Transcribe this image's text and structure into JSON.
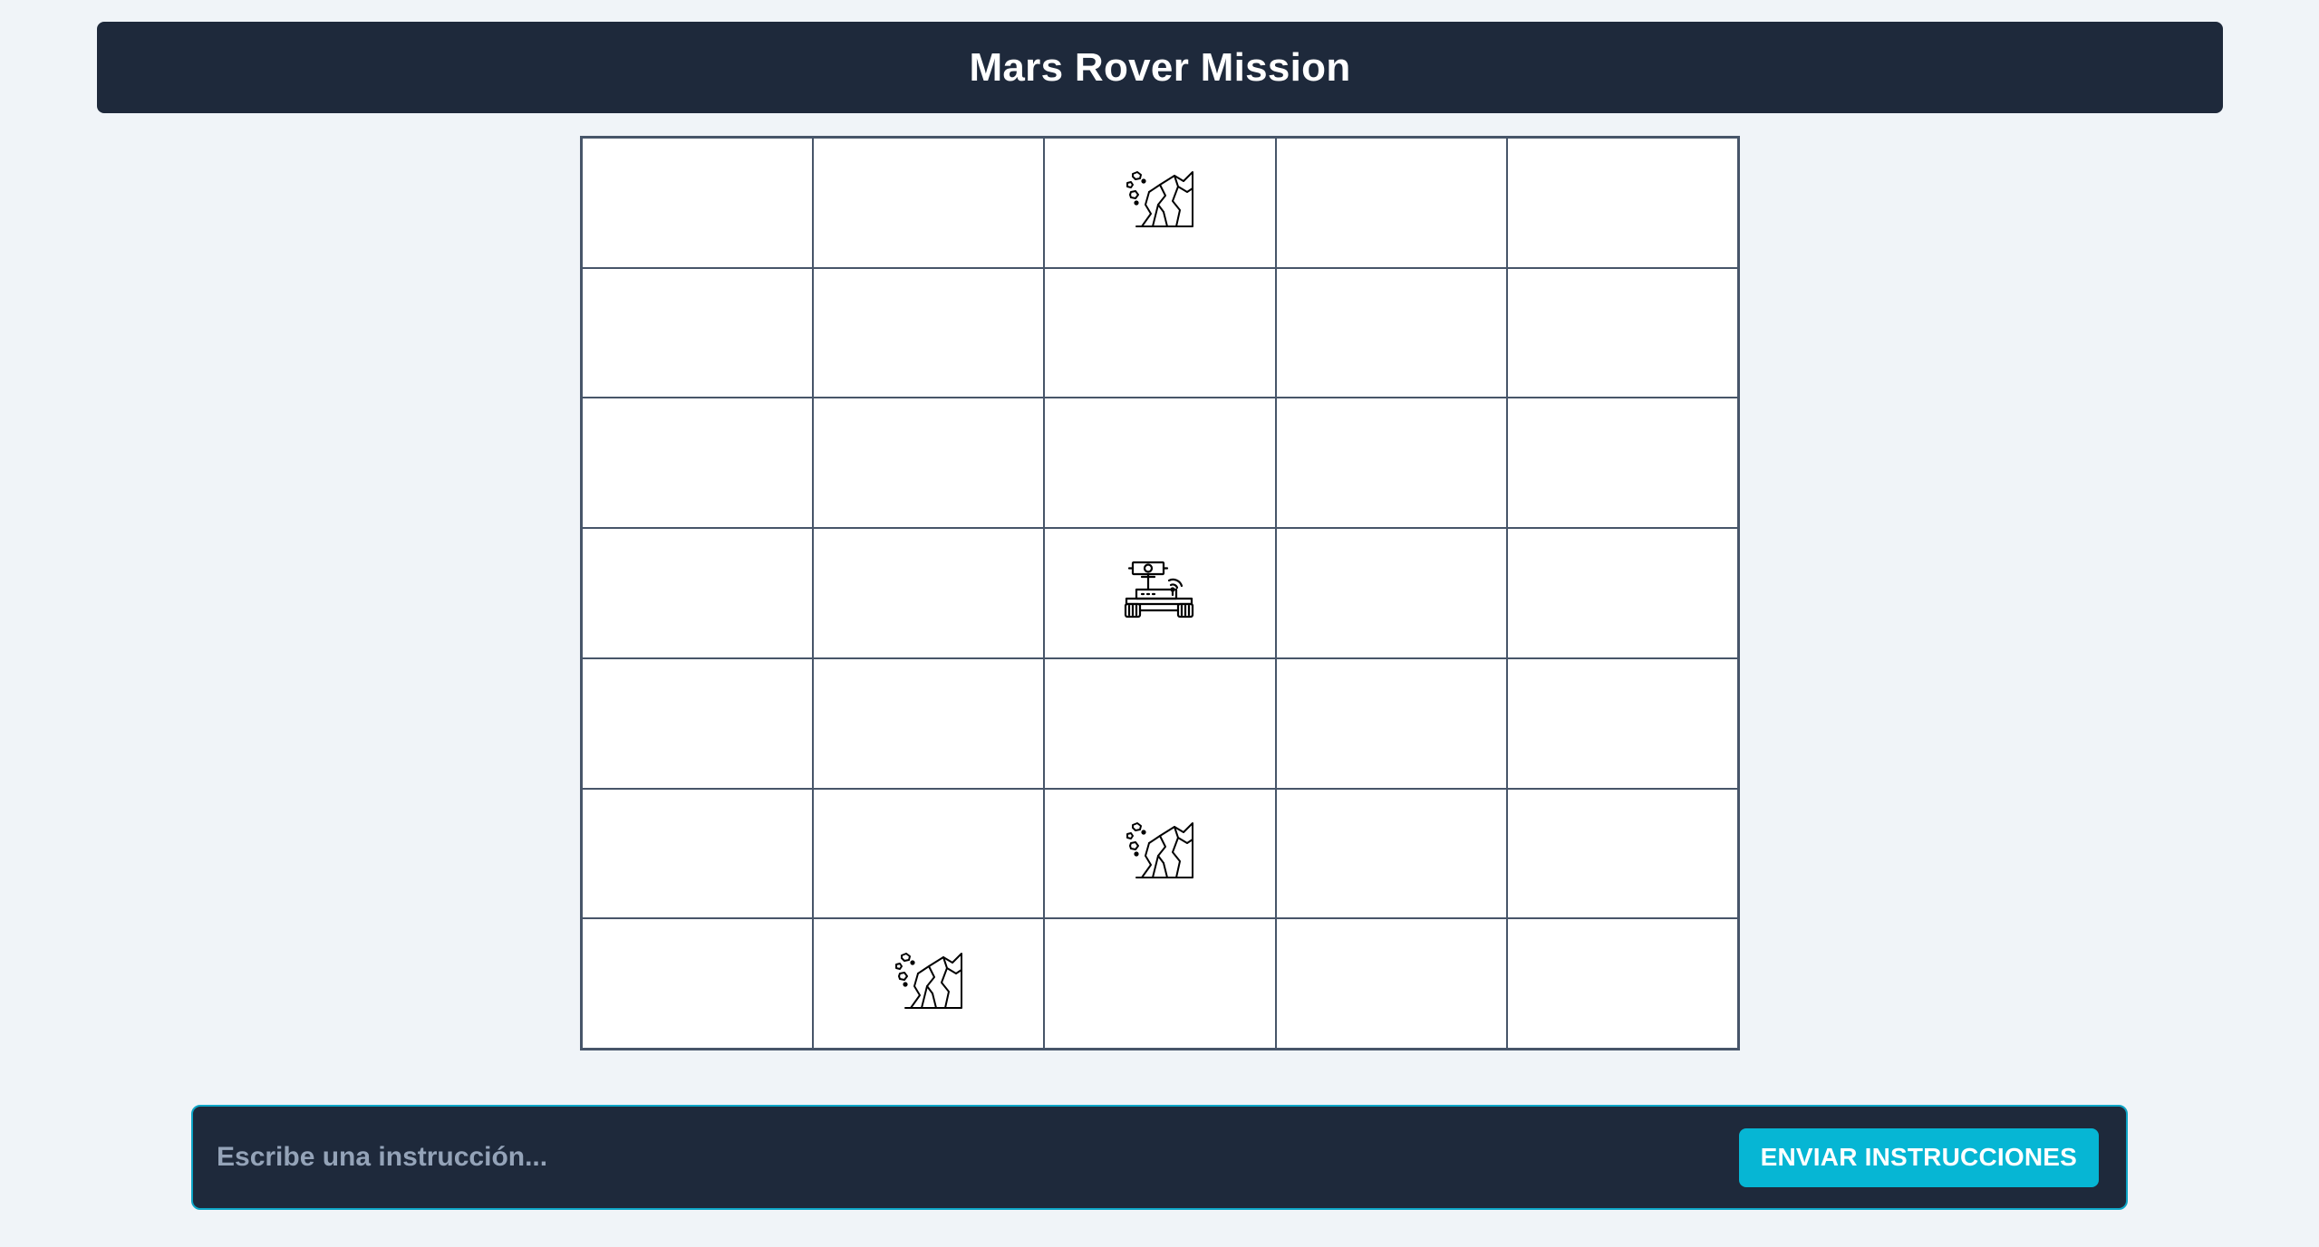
{
  "header": {
    "title": "Mars Rover Mission"
  },
  "grid": {
    "cols": 5,
    "rows": 7,
    "cells": [
      {
        "row": 0,
        "col": 2,
        "item": "obstacle"
      },
      {
        "row": 3,
        "col": 2,
        "item": "rover"
      },
      {
        "row": 5,
        "col": 2,
        "item": "obstacle"
      },
      {
        "row": 6,
        "col": 1,
        "item": "obstacle"
      }
    ],
    "icons": {
      "rover": "rover-icon",
      "obstacle": "rock-obstacle-icon"
    }
  },
  "command": {
    "placeholder": "Escribe una instrucción...",
    "value": "",
    "send_label": "ENVIAR INSTRUCCIONES"
  },
  "colors": {
    "header_bg": "#1e293b",
    "page_bg": "#f0f4f8",
    "grid_line": "#475569",
    "accent": "#06b6d4"
  }
}
